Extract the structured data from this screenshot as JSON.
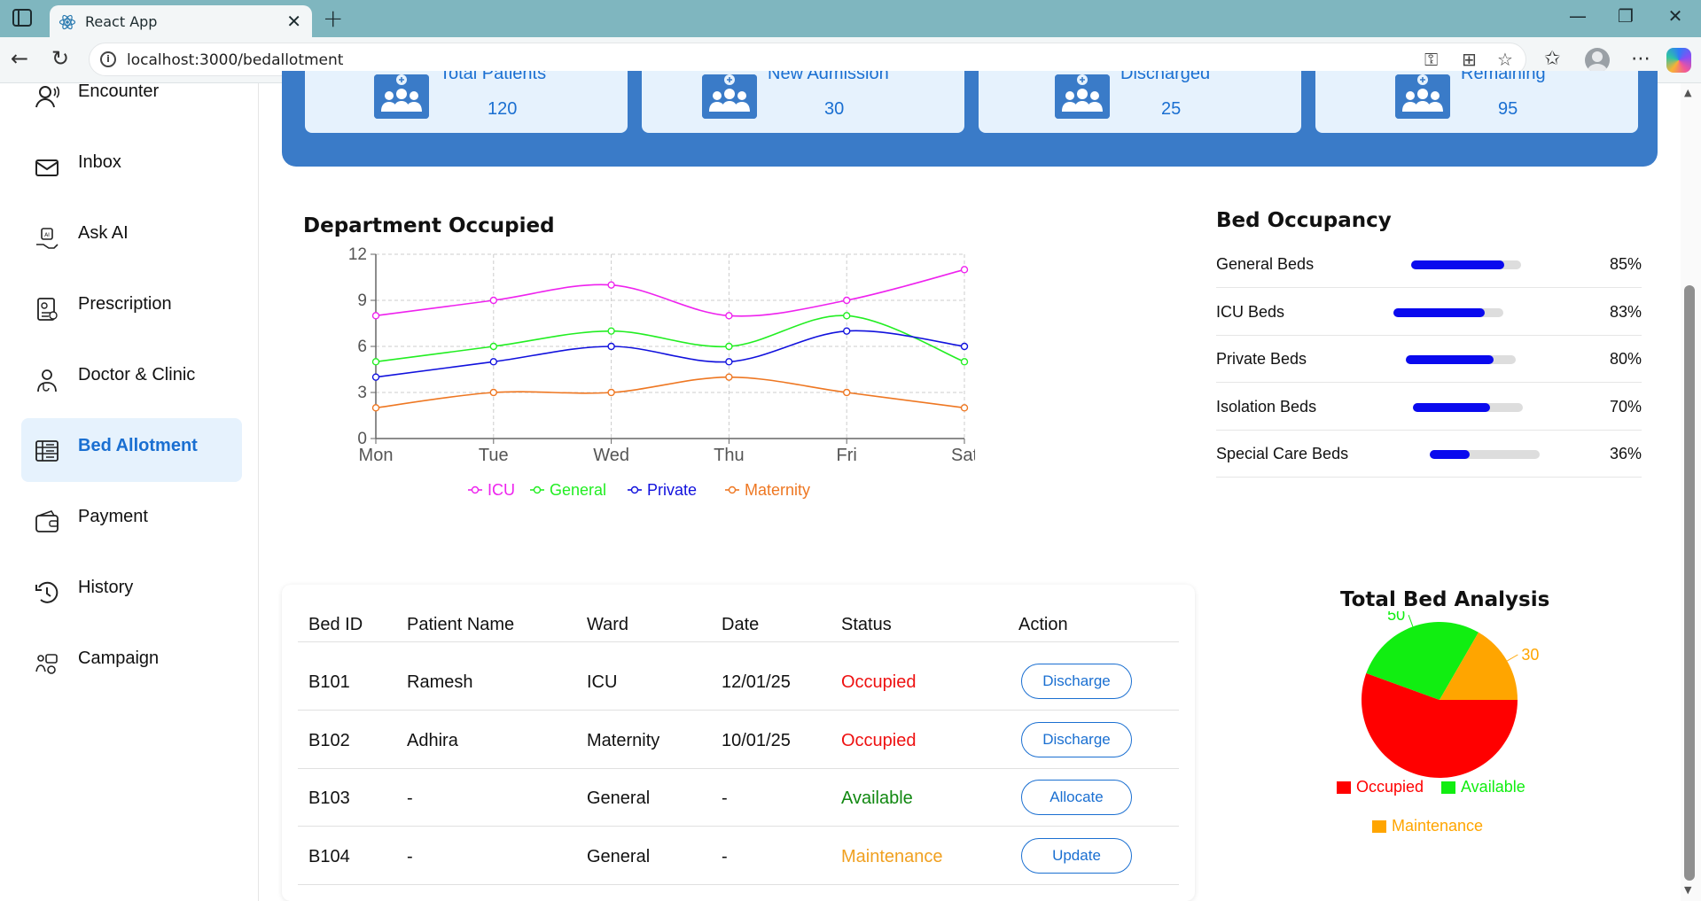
{
  "browser": {
    "tab_title": "React App",
    "url": "localhost:3000/bedallotment"
  },
  "sidebar": {
    "items": [
      {
        "label": "Encounter",
        "icon": "encounter-icon"
      },
      {
        "label": "Inbox",
        "icon": "inbox-icon"
      },
      {
        "label": "Ask AI",
        "icon": "ask-ai-icon"
      },
      {
        "label": "Prescription",
        "icon": "prescription-icon"
      },
      {
        "label": "Doctor & Clinic",
        "icon": "doctor-icon"
      },
      {
        "label": "Bed Allotment",
        "icon": "bed-allotment-icon",
        "active": true
      },
      {
        "label": "Payment",
        "icon": "wallet-icon"
      },
      {
        "label": "History",
        "icon": "history-icon"
      },
      {
        "label": "Campaign",
        "icon": "campaign-icon"
      }
    ]
  },
  "stats": [
    {
      "label": "Total Patients",
      "value": "120"
    },
    {
      "label": "New Admission",
      "value": "30"
    },
    {
      "label": "Discharged",
      "value": "25"
    },
    {
      "label": "Remaining",
      "value": "95"
    }
  ],
  "chart_data": [
    {
      "type": "line",
      "title": "Department Occupied",
      "x": [
        "Mon",
        "Tue",
        "Wed",
        "Thu",
        "Fri",
        "Sat"
      ],
      "ylim": [
        0,
        12
      ],
      "yticks": [
        "0",
        "3",
        "6",
        "9",
        "12"
      ],
      "grid": true,
      "legend": "bottom",
      "series": [
        {
          "name": "ICU",
          "color": "#ee22ee",
          "values": [
            8,
            9,
            10,
            8,
            9,
            11
          ]
        },
        {
          "name": "General",
          "color": "#22ee22",
          "values": [
            5,
            6,
            7,
            6,
            8,
            5
          ]
        },
        {
          "name": "Private",
          "color": "#1111dd",
          "values": [
            4,
            5,
            6,
            5,
            7,
            6
          ]
        },
        {
          "name": "Maternity",
          "color": "#ee7722",
          "values": [
            2,
            3,
            3,
            4,
            3,
            2
          ]
        }
      ]
    },
    {
      "type": "pie",
      "title": "Total Bed Analysis",
      "legend": "bottom",
      "series": [
        {
          "name": "Occupied",
          "color": "#ff0000",
          "value": 100
        },
        {
          "name": "Available",
          "color": "#11ee11",
          "value": 50
        },
        {
          "name": "Maintenance",
          "color": "#ffa500",
          "value": 30
        }
      ],
      "data_labels": [
        "30",
        "50"
      ]
    }
  ],
  "occupancy": {
    "title": "Bed Occupancy",
    "rows": [
      {
        "label": "General Beds",
        "pct_text": "85%",
        "value": 0.85
      },
      {
        "label": "ICU Beds",
        "pct_text": "83%",
        "value": 0.83
      },
      {
        "label": "Private Beds",
        "pct_text": "80%",
        "value": 0.8
      },
      {
        "label": "Isolation Beds",
        "pct_text": "70%",
        "value": 0.7
      },
      {
        "label": "Special Care Beds",
        "pct_text": "36%",
        "value": 0.36
      }
    ],
    "bar_color": "#0a0aee"
  },
  "table": {
    "headers": [
      "Bed ID",
      "Patient Name",
      "Ward",
      "Date",
      "Status",
      "Action"
    ],
    "rows": [
      {
        "bed_id": "B101",
        "patient": "Ramesh",
        "ward": "ICU",
        "date": "12/01/25",
        "status": "Occupied",
        "status_color": "#ee1111",
        "action": "Discharge"
      },
      {
        "bed_id": "B102",
        "patient": "Adhira",
        "ward": "Maternity",
        "date": "10/01/25",
        "status": "Occupied",
        "status_color": "#ee1111",
        "action": "Discharge"
      },
      {
        "bed_id": "B103",
        "patient": "-",
        "ward": "General",
        "date": "-",
        "status": "Available",
        "status_color": "#118811",
        "action": "Allocate"
      },
      {
        "bed_id": "B104",
        "patient": "-",
        "ward": "General",
        "date": "-",
        "status": "Maintenance",
        "status_color": "#f0a020",
        "action": "Update"
      }
    ]
  },
  "colors": {
    "accent": "#1a6fd1",
    "banner": "#3a7bc8",
    "card": "#e6f2fd"
  }
}
